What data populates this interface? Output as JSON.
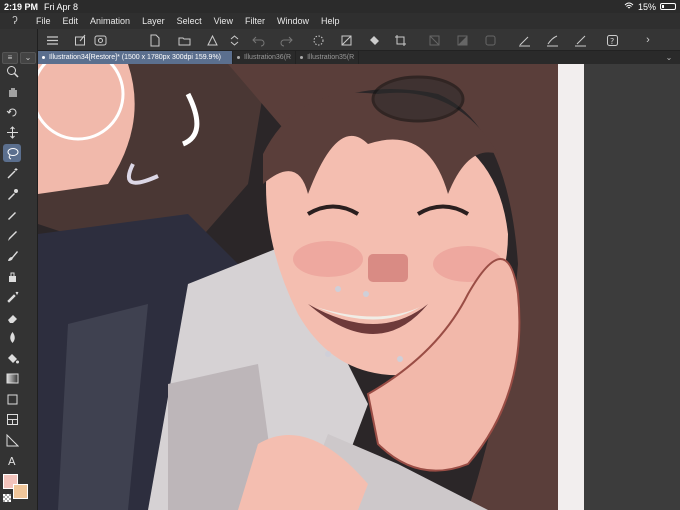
{
  "status": {
    "time": "2:19 PM",
    "date": "Fri Apr 8",
    "battery_percent": "15%",
    "battery_level": 0.15
  },
  "menu": {
    "items": [
      "File",
      "Edit",
      "Animation",
      "Layer",
      "Select",
      "View",
      "Filter",
      "Window",
      "Help"
    ]
  },
  "tabs": [
    {
      "label": "Illustration34[Restore]* (1500 x 1780px 300dpi 159.9%)"
    },
    {
      "label": "Illustration36(R"
    },
    {
      "label": "Illustration35(R"
    }
  ],
  "tools": [
    "zoom-icon",
    "hand-icon",
    "rotate-icon",
    "move-icon",
    "lasso-icon",
    "magic-wand-icon",
    "eyedropper-icon",
    "pen-icon",
    "pencil-icon",
    "brush-icon",
    "airbrush-icon",
    "decoration-icon",
    "eraser-icon",
    "blend-icon",
    "fill-icon",
    "gradient-icon",
    "figure-icon",
    "frame-icon",
    "ruler-icon",
    "text-icon"
  ],
  "colors": {
    "accent": "#5b6f8e",
    "main_color": "#f3c4bd",
    "sub_color": "#f0c69a"
  }
}
